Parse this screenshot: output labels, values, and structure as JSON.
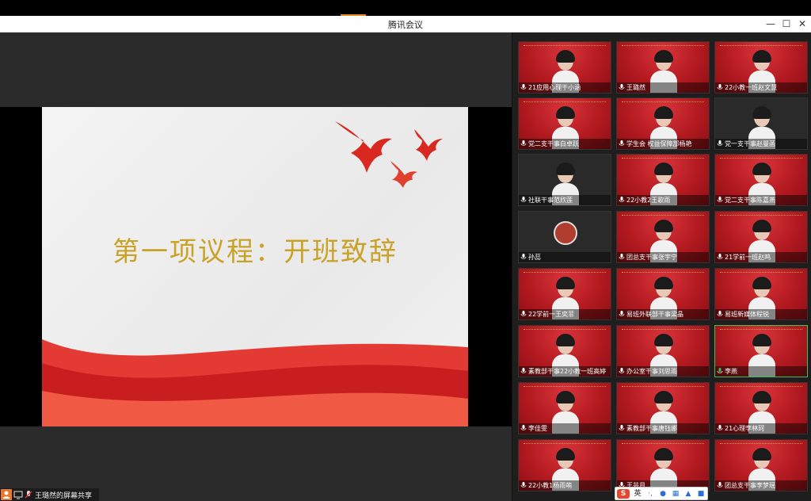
{
  "window": {
    "title": "腾讯会议",
    "minimize": "—",
    "maximize": "☐",
    "close": "✕"
  },
  "slide": {
    "heading": "第一项议程：开班致辞"
  },
  "participants": [
    {
      "name": "21应用心理干小涵"
    },
    {
      "name": "王璐然"
    },
    {
      "name": "22小教一班赵文慧"
    },
    {
      "name": "党二支干事白卓跃"
    },
    {
      "name": "学生会 权益保障部杨艳"
    },
    {
      "name": "党一支干事赵曼菡"
    },
    {
      "name": "社联干事范欣莲"
    },
    {
      "name": "22小教2王歌雨"
    },
    {
      "name": "党二支干事陈嘉燕"
    },
    {
      "name": "孙蕊"
    },
    {
      "name": "团总支干事张宇宁"
    },
    {
      "name": "21学前一班赵鸣"
    },
    {
      "name": "22学前一王奕菲"
    },
    {
      "name": "易班外联部干事梁晶"
    },
    {
      "name": "易班新媒体程锐"
    },
    {
      "name": "素教部干事22小教一班高婷"
    },
    {
      "name": "办公室干事刘思雨"
    },
    {
      "name": "李燕"
    },
    {
      "name": "李佳雯"
    },
    {
      "name": "素教部干事唐钰娜"
    },
    {
      "name": "21心理李林珂"
    },
    {
      "name": "22小教1杨雨萌"
    },
    {
      "name": "王芸月"
    },
    {
      "name": "团总支干事李梦瑶"
    }
  ],
  "footer": {
    "screen_share": "王璐然的屏幕共享"
  },
  "ime": {
    "logo": "S",
    "mode": "英"
  },
  "colors": {
    "slide_heading": "#c9a227",
    "tile_red": "#b31a20",
    "active_border": "#3fbf57"
  }
}
